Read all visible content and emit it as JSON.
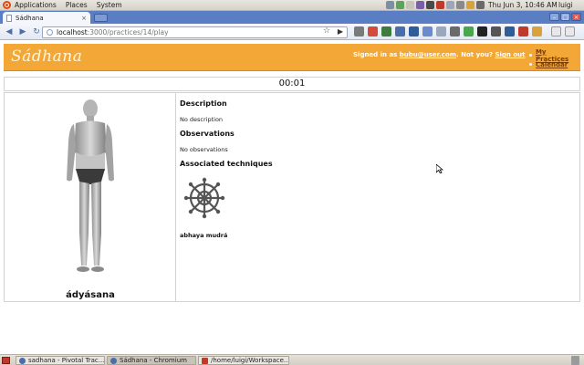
{
  "panel": {
    "menus": [
      "Applications",
      "Places",
      "System"
    ],
    "clock": "Thu Jun  3, 10:46 AM",
    "user": "luigi"
  },
  "browser": {
    "tab_title": "Sádhana",
    "tab_close": "×",
    "url_host": "localhost",
    "url_path": ":3000/practices/14/play",
    "back_icon": "◀",
    "forward_icon": "▶",
    "reload_icon": "↻",
    "star_icon": "☆",
    "go_icon": "▶"
  },
  "app": {
    "brand": "Sádhana",
    "signed_in_prefix": "Signed in as ",
    "user_email": "bubu@user.com",
    "not_you": ". Not you? ",
    "sign_out": "Sign out",
    "nav": [
      "My Practices",
      "Calendar"
    ],
    "accent_color": "#f3a736"
  },
  "timer": "00:01",
  "pose": {
    "name": "ádyásana"
  },
  "details": {
    "description_heading": "Description",
    "description_text": "No description",
    "observations_heading": "Observations",
    "observations_text": "No observations",
    "techniques_heading": "Associated techniques",
    "technique_name": "abhaya mudrá"
  },
  "taskbar": {
    "tasks": [
      "sadhana - Pivotal Trac...",
      "Sádhana - Chromium",
      "/home/luigi/Workspace..."
    ]
  }
}
